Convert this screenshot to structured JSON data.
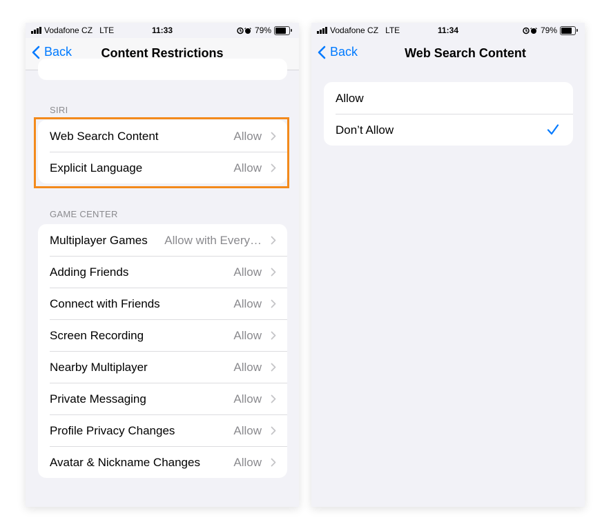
{
  "left": {
    "status": {
      "carrier": "Vodafone CZ",
      "network": "LTE",
      "time": "11:33",
      "battery": "79%"
    },
    "nav": {
      "back_label": "Back",
      "title": "Content Restrictions"
    },
    "siri_header": "SIRI",
    "siri_rows": [
      {
        "label": "Web Search Content",
        "value": "Allow"
      },
      {
        "label": "Explicit Language",
        "value": "Allow"
      }
    ],
    "game_center_header": "GAME CENTER",
    "game_center_rows": [
      {
        "label": "Multiplayer Games",
        "value": "Allow with Every…"
      },
      {
        "label": "Adding Friends",
        "value": "Allow"
      },
      {
        "label": "Connect with Friends",
        "value": "Allow"
      },
      {
        "label": "Screen Recording",
        "value": "Allow"
      },
      {
        "label": "Nearby Multiplayer",
        "value": "Allow"
      },
      {
        "label": "Private Messaging",
        "value": "Allow"
      },
      {
        "label": "Profile Privacy Changes",
        "value": "Allow"
      },
      {
        "label": "Avatar & Nickname Changes",
        "value": "Allow"
      }
    ]
  },
  "right": {
    "status": {
      "carrier": "Vodafone CZ",
      "network": "LTE",
      "time": "11:34",
      "battery": "79%"
    },
    "nav": {
      "back_label": "Back",
      "title": "Web Search Content"
    },
    "options": [
      {
        "label": "Allow",
        "selected": false
      },
      {
        "label": "Don’t Allow",
        "selected": true
      }
    ]
  },
  "colors": {
    "accent": "#007aff",
    "highlight": "#f38a1c",
    "background": "#f2f2f7"
  },
  "icons": [
    "signal-icon",
    "alarm-icon",
    "battery-icon",
    "back-chevron-icon",
    "chevron-right-icon",
    "checkmark-icon"
  ]
}
